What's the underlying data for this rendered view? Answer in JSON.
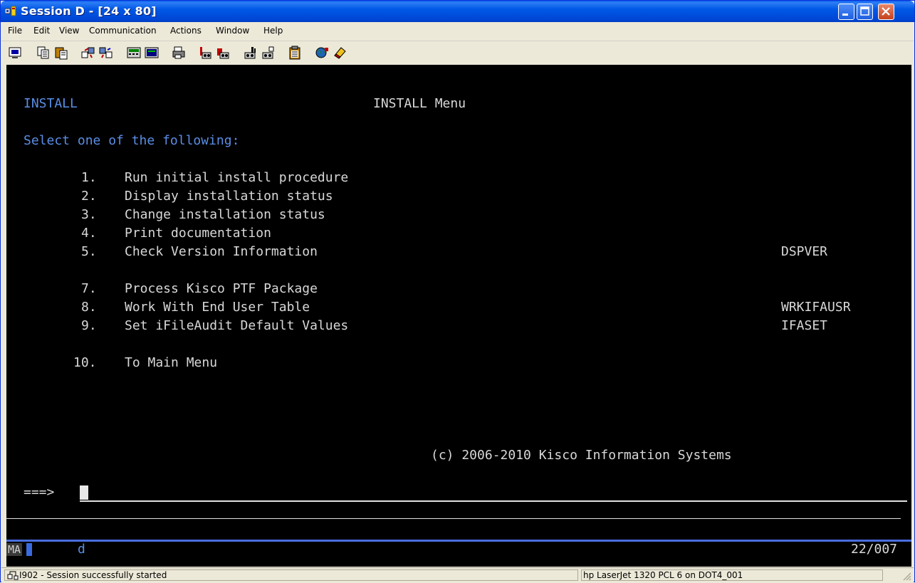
{
  "window": {
    "title": "Session D - [24 x 80]"
  },
  "menu": [
    "File",
    "Edit",
    "View",
    "Communication",
    "Actions",
    "Window",
    "Help"
  ],
  "toolbar": [
    {
      "name": "display-session-icon",
      "color": "#0000a0"
    },
    {
      "name": "copy-icon",
      "color": "#303030"
    },
    {
      "name": "paste-icon",
      "color": "#c08000"
    },
    {
      "name": "send-icon",
      "color": "#c00000"
    },
    {
      "name": "receive-icon",
      "color": "#0000c0"
    },
    {
      "name": "keypad-icon",
      "color": "#008000"
    },
    {
      "name": "screen-icon",
      "color": "#000080"
    },
    {
      "name": "print-icon",
      "color": "#404040"
    },
    {
      "name": "macro-record-icon",
      "color": "#c00000"
    },
    {
      "name": "macro-play-icon",
      "color": "#c00000"
    },
    {
      "name": "macro-stop-icon",
      "color": "#404040"
    },
    {
      "name": "macro-edit-icon",
      "color": "#404040"
    },
    {
      "name": "clipboard-icon",
      "color": "#c08000"
    },
    {
      "name": "globe-icon",
      "color": "#008000"
    },
    {
      "name": "eraser-icon",
      "color": "#c00000"
    }
  ],
  "terminal": {
    "screen_id": "INSTALL",
    "title": "INSTALL Menu",
    "prompt": "Select one of the following:",
    "options": [
      {
        "num": "1.",
        "label": "Run initial install procedure",
        "cmd": ""
      },
      {
        "num": "2.",
        "label": "Display installation status",
        "cmd": ""
      },
      {
        "num": "3.",
        "label": "Change installation status",
        "cmd": ""
      },
      {
        "num": "4.",
        "label": "Print documentation",
        "cmd": ""
      },
      {
        "num": "5.",
        "label": "Check Version Information",
        "cmd": "DSPVER"
      },
      {
        "num": "7.",
        "label": "Process Kisco PTF Package",
        "cmd": ""
      },
      {
        "num": "8.",
        "label": "Work With End User Table",
        "cmd": "WRKIFAUSR"
      },
      {
        "num": "9.",
        "label": "Set iFileAudit Default Values",
        "cmd": "IFASET"
      },
      {
        "num": "10.",
        "label": "To Main Menu",
        "cmd": ""
      }
    ],
    "copyright": "(c) 2006-2010 Kisco Information Systems",
    "command_prompt": "===>",
    "command_value": "",
    "oia_left": "MA",
    "oia_mid": "d",
    "oia_right": "22/007"
  },
  "status": {
    "message": "I902 - Session successfully started",
    "printer": "hp LaserJet 1320 PCL 6 on DOT4_001"
  }
}
